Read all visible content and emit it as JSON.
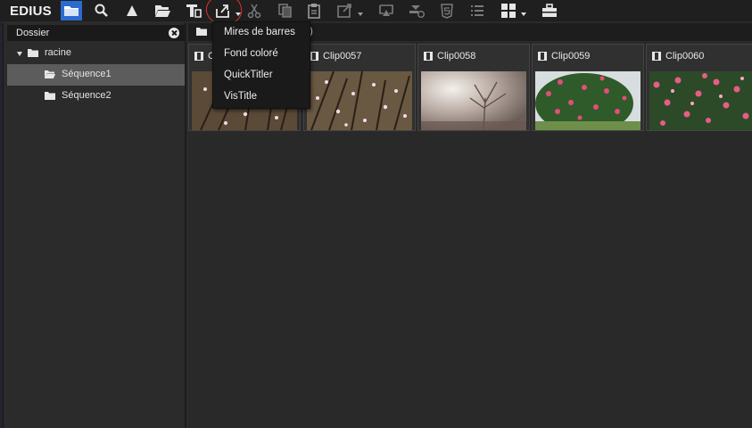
{
  "app": {
    "logo": "EDIUS"
  },
  "toolbar": {
    "buttons": [
      {
        "name": "open-folder-icon",
        "active": true
      },
      {
        "name": "search-icon"
      },
      {
        "name": "up-arrow-icon"
      },
      {
        "name": "folder-open-icon"
      },
      {
        "name": "title-add-icon"
      },
      {
        "name": "new-clip-icon"
      },
      {
        "name": "cut-icon"
      },
      {
        "name": "copy-icon"
      },
      {
        "name": "paste-icon"
      },
      {
        "name": "export-icon"
      },
      {
        "name": "send-icon"
      },
      {
        "name": "timeline-add-icon"
      },
      {
        "name": "html5-icon"
      },
      {
        "name": "list-view-icon"
      },
      {
        "name": "grid-view-icon"
      },
      {
        "name": "toolbox-icon"
      }
    ]
  },
  "folder_panel": {
    "title": "Dossier",
    "tree": [
      {
        "label": "racine",
        "expanded": true
      },
      {
        "label": "Séquence1",
        "selected": true
      },
      {
        "label": "Séquence2"
      }
    ]
  },
  "bin": {
    "path_suffix": "0)",
    "clips": [
      {
        "label": "C",
        "thumb": "blossom-branches"
      },
      {
        "label": "Clip0057",
        "thumb": "blossom-branches"
      },
      {
        "label": "Clip0058",
        "thumb": "hazy-tree"
      },
      {
        "label": "Clip0059",
        "thumb": "camellia-bush"
      },
      {
        "label": "Clip0060",
        "thumb": "camellia-bush"
      }
    ]
  },
  "new_clip_menu": {
    "items": [
      "Mires de barres",
      "Fond coloré",
      "QuickTitler",
      "VisTitle"
    ]
  },
  "colors": {
    "toolbar_bg": "#1f1f1f",
    "panel_bg": "#2b2b2b",
    "selected_row": "#5c5c5c",
    "active_button": "#2a6bd1",
    "annotation_circle": "#e03030"
  }
}
